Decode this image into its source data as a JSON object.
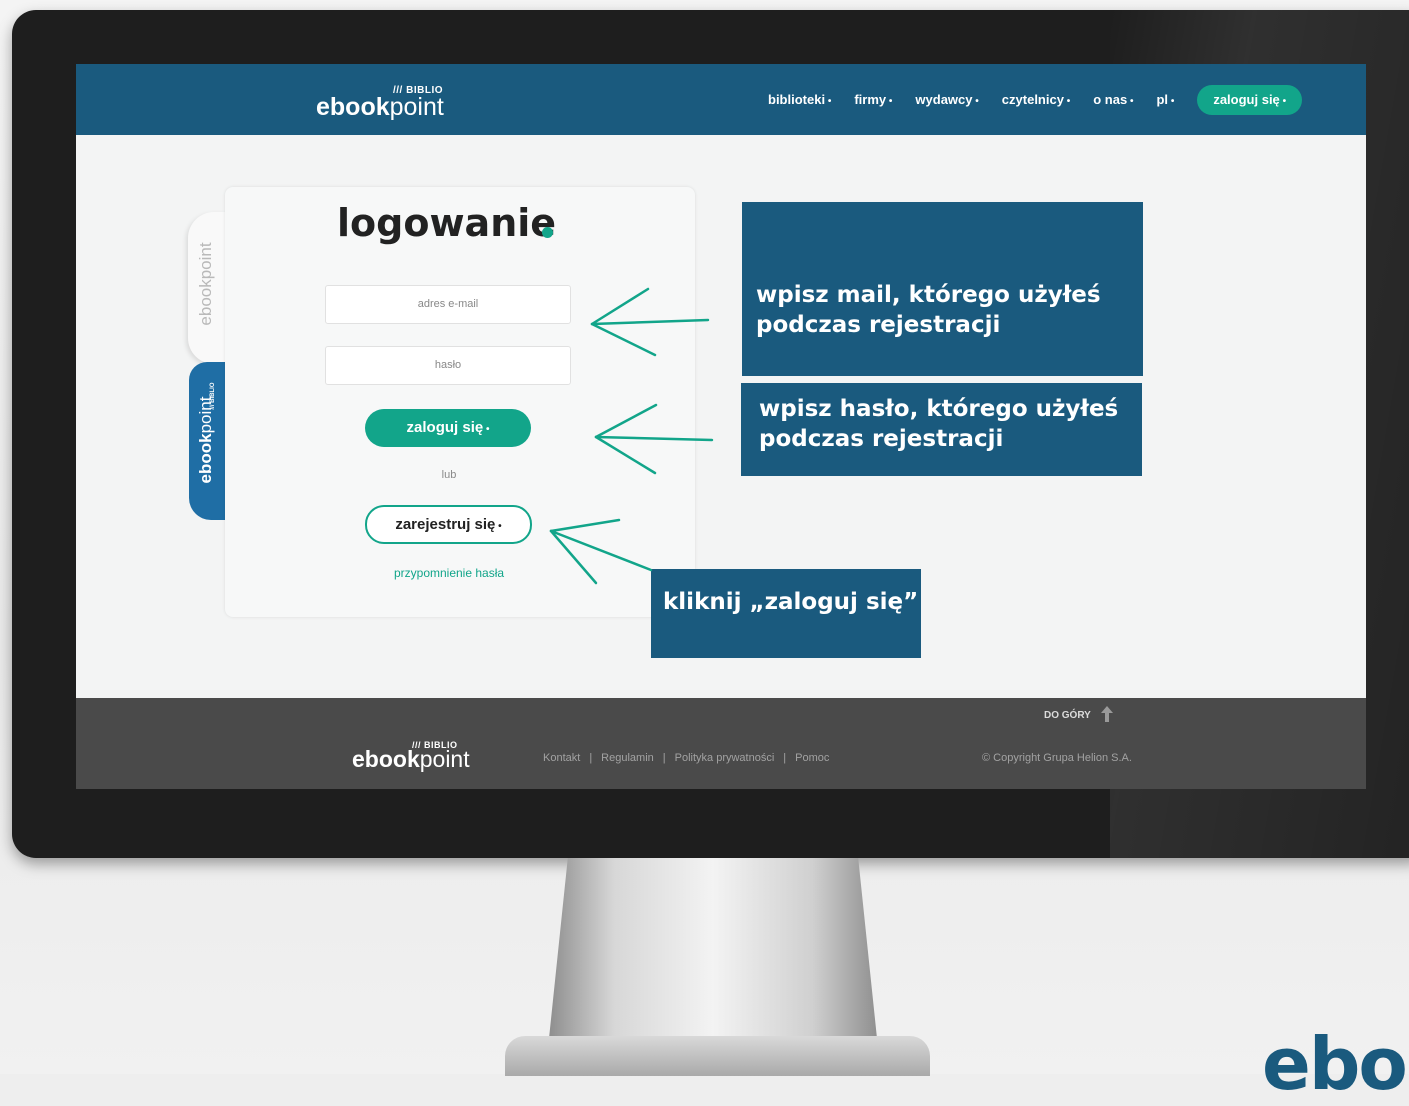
{
  "brand": {
    "prefix": "/// BIBLIO",
    "word_bold": "ebook",
    "word_light": "point"
  },
  "nav": {
    "items": [
      "biblioteki",
      "firmy",
      "wydawcy",
      "czytelnicy",
      "o nas",
      "pl"
    ],
    "login": "zaloguj się"
  },
  "side_tabs": {
    "tab1": "ebookpoint",
    "tab2_bold": "ebook",
    "tab2_light": "point",
    "tab2_prefix": "/// BIBLIO"
  },
  "login_card": {
    "title": "logowanie",
    "email_placeholder": "adres e-mail",
    "password_placeholder": "hasło",
    "login_button": "zaloguj się",
    "or_text": "lub",
    "register_button": "zarejestruj się",
    "forgot_link": "przypomnienie hasła"
  },
  "callouts": {
    "email_line1": "wpisz mail, którego użyłeś",
    "email_line2": "podczas rejestracji",
    "password_line1": "wpisz hasło, którego użyłeś",
    "password_line2": "podczas rejestracji",
    "click": "kliknij „zaloguj się”"
  },
  "footer": {
    "to_top": "DO GÓRY",
    "links": [
      "Kontakt",
      "Regulamin",
      "Polityka prywatności",
      "Pomoc"
    ],
    "copyright": "© Copyright Grupa Helion S.A."
  },
  "corner_logo": "ebo",
  "colors": {
    "primary": "#1a5a7e",
    "accent": "#12a58a",
    "footer": "#4a4a4a"
  }
}
